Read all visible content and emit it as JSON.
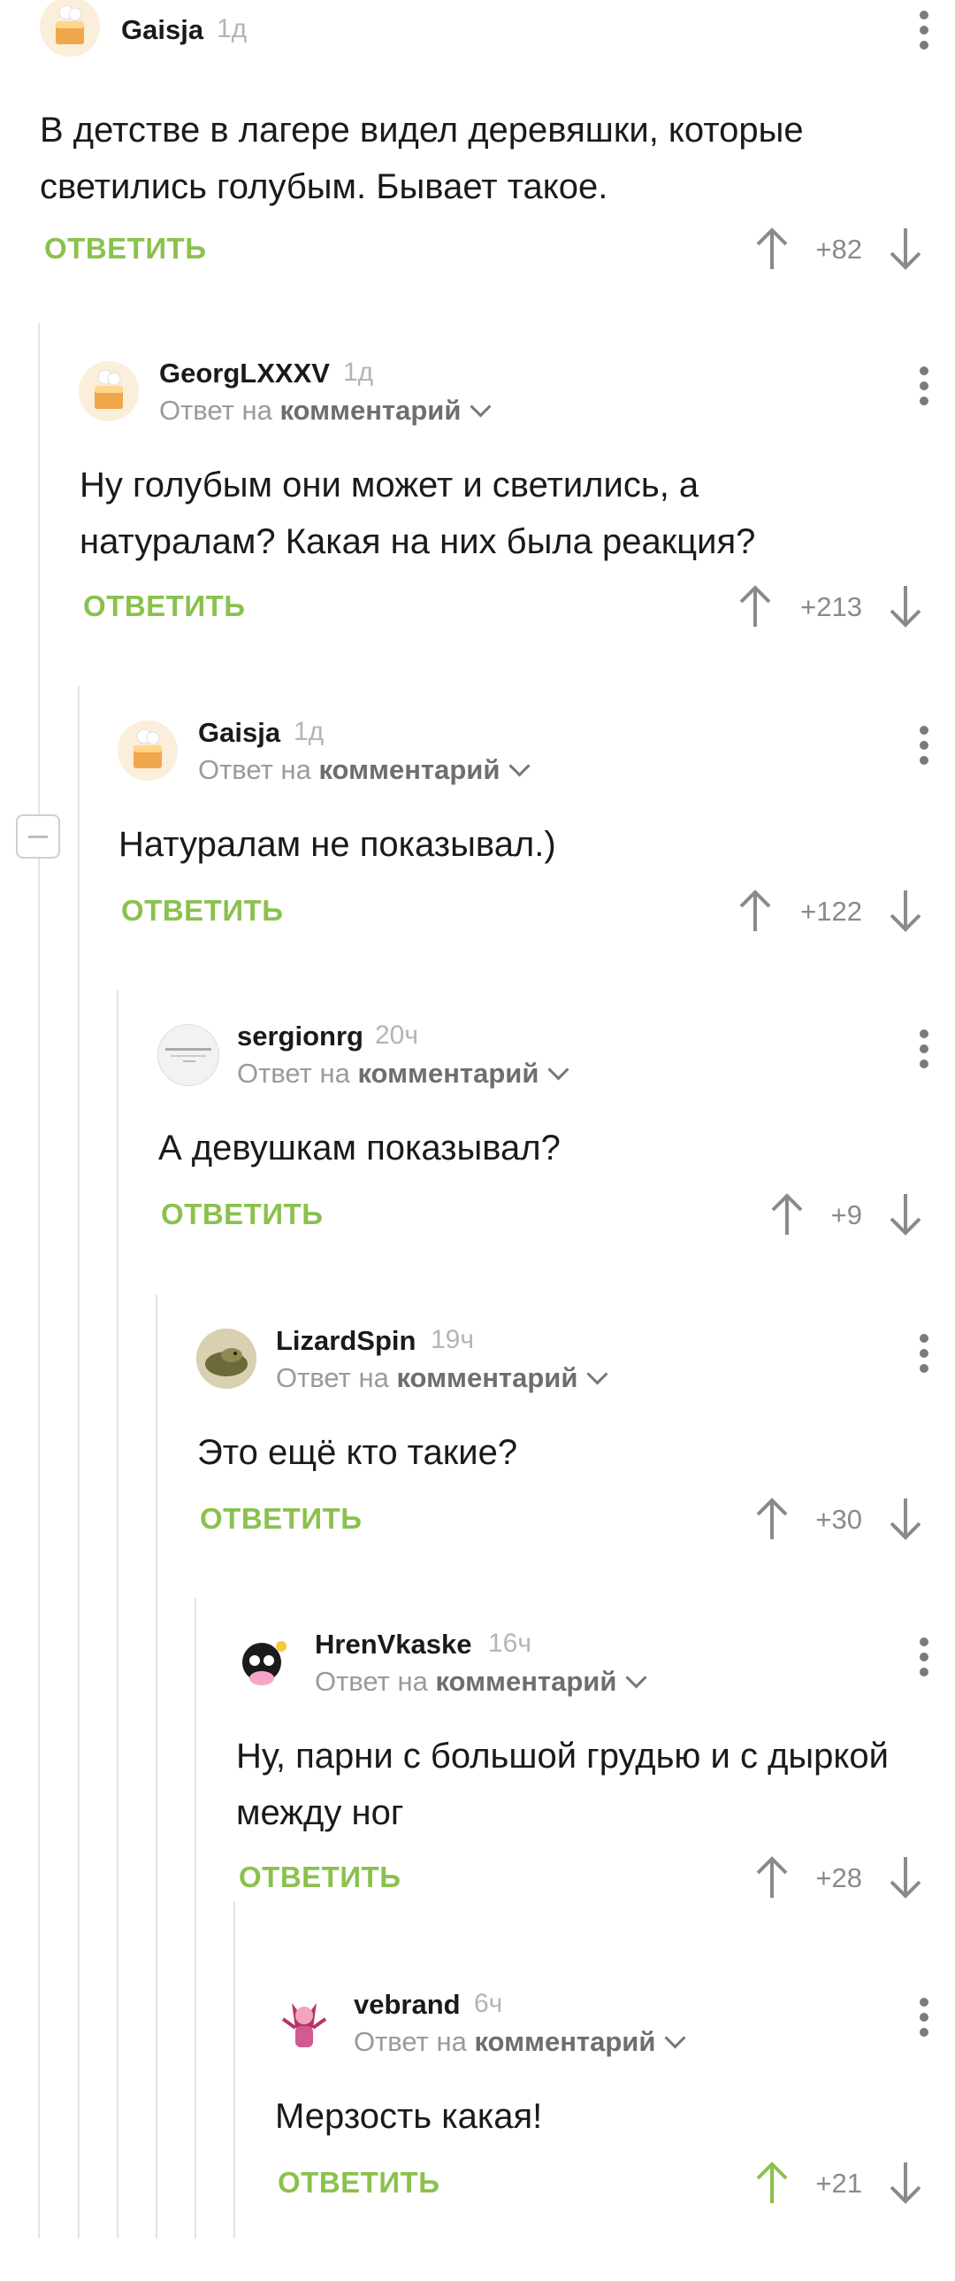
{
  "comments": [
    {
      "user": "Gaisja",
      "time": "1д",
      "reply_to_prefix": "",
      "reply_to_word": "",
      "text": "В детстве в лагере видел деревяшки, которые светились голубым. Бывает такое.",
      "reply_label": "ОТВЕТИТЬ",
      "score": "+82",
      "avatar": "cake-avatar",
      "up_active": false
    },
    {
      "user": "GeorgLXXXV",
      "time": "1д",
      "reply_to_prefix": "Ответ на",
      "reply_to_word": "комментарий",
      "text": "Ну голубым они может и светились, а натуралам? Какая на них была реакция?",
      "reply_label": "ОТВЕТИТЬ",
      "score": "+213",
      "avatar": "cake-avatar",
      "up_active": false
    },
    {
      "user": "Gaisja",
      "time": "1д",
      "reply_to_prefix": "Ответ на",
      "reply_to_word": "комментарий",
      "text": "Натуралам не показывал.)",
      "reply_label": "ОТВЕТИТЬ",
      "score": "+122",
      "avatar": "cake-avatar",
      "up_active": false
    },
    {
      "user": "sergionrg",
      "time": "20ч",
      "reply_to_prefix": "Ответ на",
      "reply_to_word": "комментарий",
      "text": "А девушкам показывал?",
      "reply_label": "ОТВЕТИТЬ",
      "score": "+9",
      "avatar": "document-avatar",
      "up_active": false
    },
    {
      "user": "LizardSpin",
      "time": "19ч",
      "reply_to_prefix": "Ответ на",
      "reply_to_word": "комментарий",
      "text": "Это ещё кто такие?",
      "reply_label": "ОТВЕТИТЬ",
      "score": "+30",
      "avatar": "lizard-avatar",
      "up_active": false
    },
    {
      "user": "HrenVkaske",
      "time": "16ч",
      "reply_to_prefix": "Ответ на",
      "reply_to_word": "комментарий",
      "text": "Ну, парни с большой грудью и с дыркой между ног",
      "reply_label": "ОТВЕТИТЬ",
      "score": "+28",
      "avatar": "creature-avatar",
      "up_active": false
    },
    {
      "user": "vebrand",
      "time": "6ч",
      "reply_to_prefix": "Ответ на",
      "reply_to_word": "комментарий",
      "text": "Мерзость какая!",
      "reply_label": "ОТВЕТИТЬ",
      "score": "+21",
      "avatar": "pink-character-avatar",
      "up_active": true
    }
  ],
  "colors": {
    "accent": "#8ac14d",
    "muted": "#9a9a9a",
    "tree_line": "#e3e3e3"
  }
}
